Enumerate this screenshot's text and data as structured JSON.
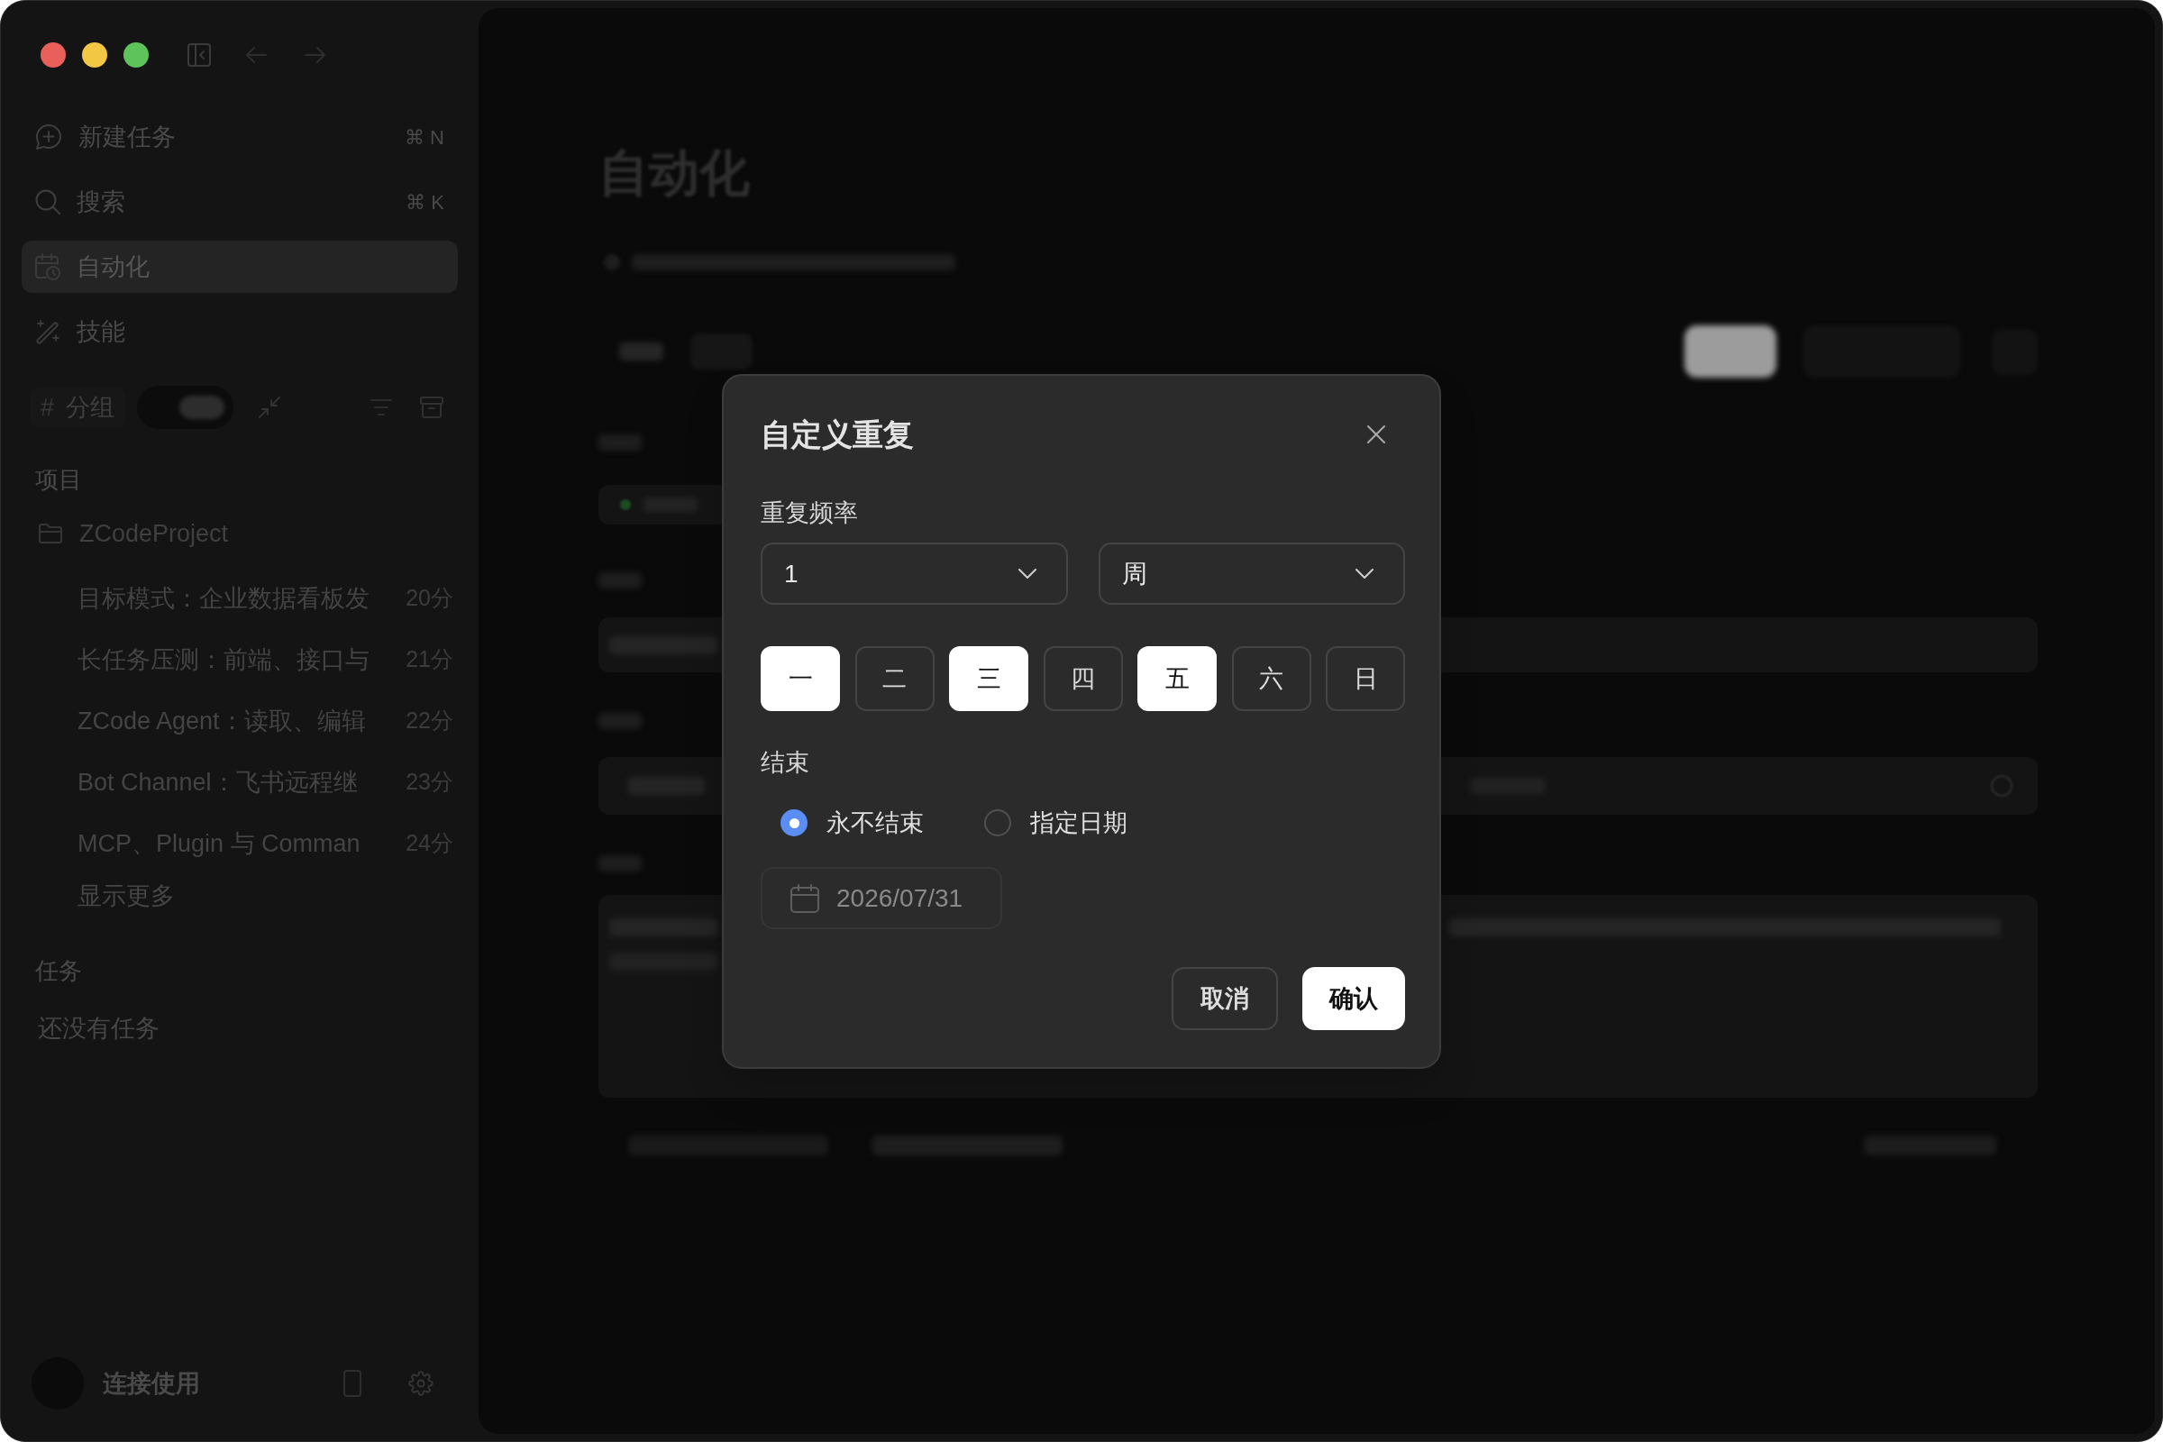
{
  "sidebar": {
    "nav": [
      {
        "label": "新建任务",
        "shortcut": "⌘ N",
        "selected": false
      },
      {
        "label": "搜索",
        "shortcut": "⌘ K",
        "selected": false
      },
      {
        "label": "自动化",
        "selected": true
      },
      {
        "label": "技能",
        "selected": false
      }
    ],
    "group_bar": {
      "symbol": "#",
      "label": "分组",
      "toggle": {
        "on": true
      }
    },
    "projects_heading": "项目",
    "project": {
      "name": "ZCodeProject",
      "tasks": [
        {
          "title": "目标模式：企业数据看板发",
          "time": "20分"
        },
        {
          "title": "长任务压测：前端、接口与",
          "time": "21分"
        },
        {
          "title": "ZCode Agent：读取、编辑",
          "time": "22分"
        },
        {
          "title": "Bot Channel：飞书远程继",
          "time": "23分"
        },
        {
          "title": "MCP、Plugin 与 Comman",
          "time": "24分"
        }
      ],
      "show_more": "显示更多"
    },
    "tasks_heading": "任务",
    "tasks_empty": "还没有任务",
    "footer": {
      "label": "连接使用"
    }
  },
  "main": {
    "title": "自动化"
  },
  "dialog": {
    "title": "自定义重复",
    "frequency": {
      "label": "重复频率",
      "interval": {
        "value": "1"
      },
      "unit": {
        "value": "周"
      }
    },
    "days": [
      {
        "label": "一",
        "selected": true
      },
      {
        "label": "二",
        "selected": false
      },
      {
        "label": "三",
        "selected": true
      },
      {
        "label": "四",
        "selected": false
      },
      {
        "label": "五",
        "selected": true
      },
      {
        "label": "六",
        "selected": false
      },
      {
        "label": "日",
        "selected": false
      }
    ],
    "end": {
      "label": "结束",
      "options": [
        {
          "label": "永不结束",
          "selected": true
        },
        {
          "label": "指定日期",
          "selected": false
        }
      ],
      "date": {
        "value": "2026/07/31",
        "disabled": true
      }
    },
    "buttons": [
      {
        "label": "取消",
        "kind": "secondary"
      },
      {
        "label": "确认",
        "kind": "primary"
      }
    ]
  }
}
